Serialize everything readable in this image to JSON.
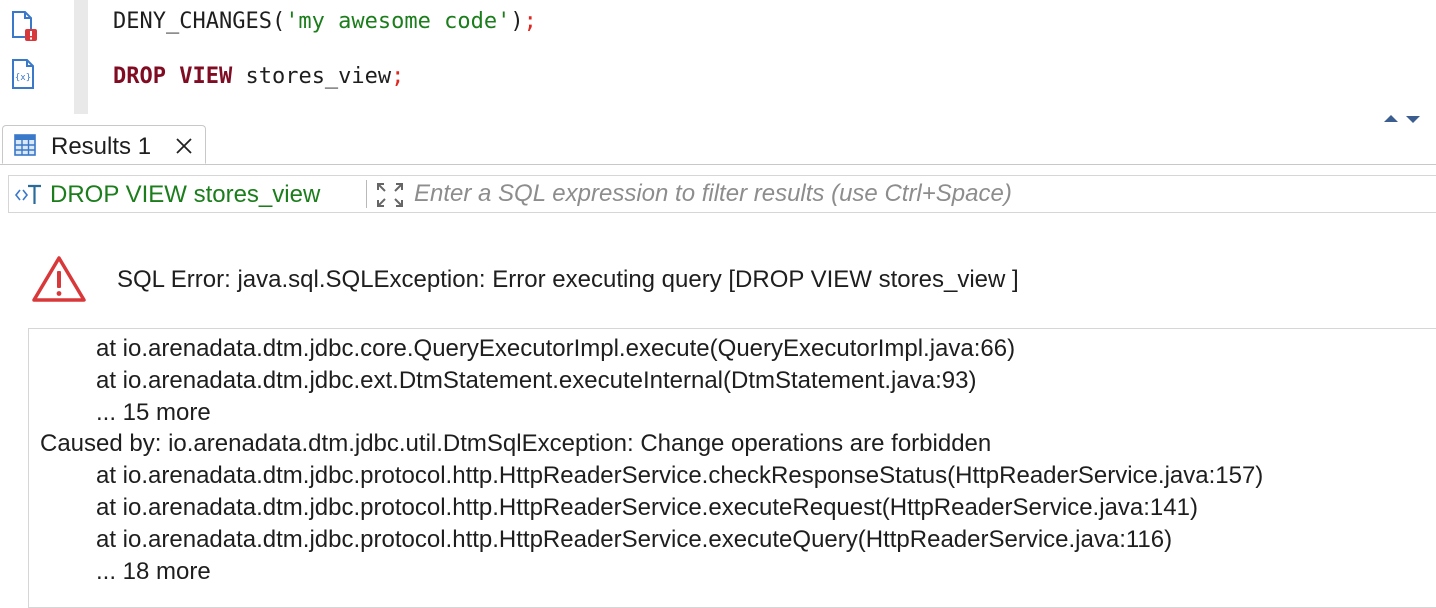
{
  "editor": {
    "line1": {
      "func": "DENY_CHANGES(",
      "string": "'my awesome code'",
      "close": ")",
      "semi": ";"
    },
    "line2": {
      "kw1": "DROP",
      "kw2": "VIEW",
      "rest": " stores_view",
      "semi": ";"
    },
    "gutter_icons": [
      "file-error-icon",
      "variable-file-icon"
    ]
  },
  "tab": {
    "label": "Results 1",
    "icon": "table-grid-icon",
    "close_icon": "close-icon"
  },
  "filter": {
    "query_label": "DROP VIEW stores_view",
    "placeholder": "Enter a SQL expression to filter results (use Ctrl+Space)"
  },
  "error": {
    "title": "SQL Error: java.sql.SQLException: Error executing query [DROP VIEW stores_view ]",
    "icon": "warning-icon"
  },
  "trace": [
    "at io.arenadata.dtm.jdbc.core.QueryExecutorImpl.execute(QueryExecutorImpl.java:66)",
    "at io.arenadata.dtm.jdbc.ext.DtmStatement.executeInternal(DtmStatement.java:93)",
    "... 15 more",
    "Caused by: io.arenadata.dtm.jdbc.util.DtmSqlException: Change operations are forbidden",
    "at io.arenadata.dtm.jdbc.protocol.http.HttpReaderService.checkResponseStatus(HttpReaderService.java:157)",
    "at io.arenadata.dtm.jdbc.protocol.http.HttpReaderService.executeRequest(HttpReaderService.java:141)",
    "at io.arenadata.dtm.jdbc.protocol.http.HttpReaderService.executeQuery(HttpReaderService.java:116)",
    "... 18 more"
  ],
  "colors": {
    "keyword": "#7f0c22",
    "string": "#1b7d1b",
    "semicolon": "#e0261f",
    "error_red": "#d9383a",
    "icon_blue": "#3a78c9"
  }
}
